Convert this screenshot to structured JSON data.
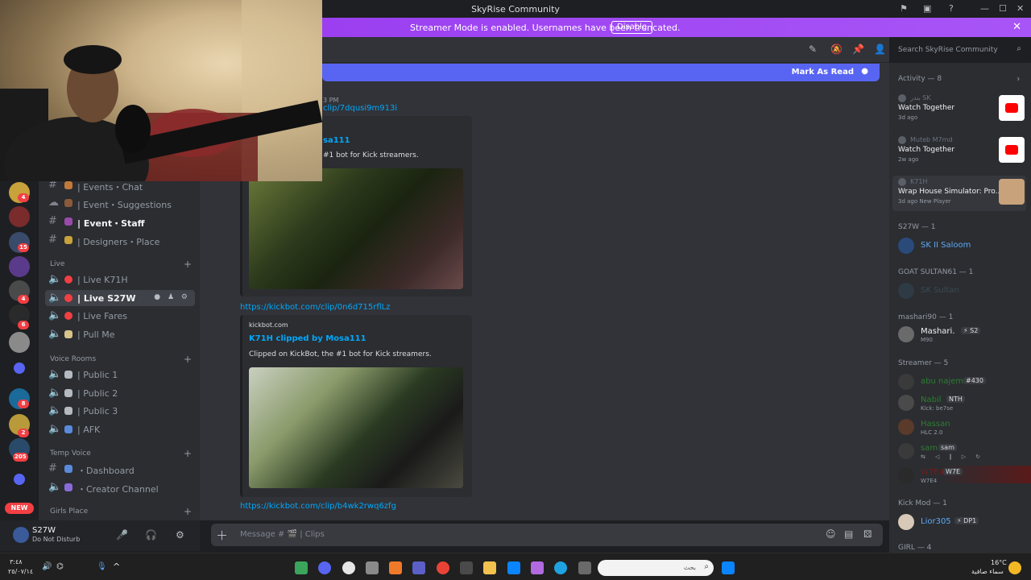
{
  "window": {
    "title": "SkyRise Community"
  },
  "banner": {
    "message": "Streamer Mode is enabled. Usernames have been truncated.",
    "disable_label": "Disable"
  },
  "header": {
    "search_placeholder": "Search SkyRise Community"
  },
  "new_messages_bar": {
    "mark_label": "Mark As Read"
  },
  "chat": {
    "timestamp": "3 PM",
    "link1": "clip/7dqusi9m913i",
    "embed1": {
      "title": "sa111",
      "desc": "#1 bot for Kick streamers."
    },
    "link2": "https://kickbot.com/clip/0n6d715rflLz",
    "embed2": {
      "site": "kickbot.com",
      "title": "K71H clipped by Mosa111",
      "desc": "Clipped on KickBot, the #1 bot for Kick streamers."
    },
    "link3": "https://kickbot.com/clip/b4wk2rwq6zfg",
    "composer_placeholder": "Message # 🎬 | Clips"
  },
  "channels": {
    "items": [
      {
        "label": "| Events・Chat",
        "type": "text"
      },
      {
        "label": "| Event・Suggestions",
        "type": "forum"
      },
      {
        "label": "| Event・Staff",
        "type": "text"
      },
      {
        "label": "| Designers・Place",
        "type": "text"
      }
    ],
    "live_category": "Live",
    "live": [
      {
        "label": "| Live K71H"
      },
      {
        "label": "| Live S27W"
      },
      {
        "label": "| Live Fares"
      },
      {
        "label": "| Pull Me"
      }
    ],
    "voice_category": "Voice Rooms",
    "voice": [
      {
        "label": "| Public 1"
      },
      {
        "label": "| Public 2"
      },
      {
        "label": "| Public 3"
      },
      {
        "label": "| AFK"
      }
    ],
    "temp_category": "Temp Voice",
    "temp": [
      {
        "label": "・Dashboard"
      },
      {
        "label": "・Creator Channel"
      }
    ],
    "girls_category": "Girls Place"
  },
  "user": {
    "name": "S27W",
    "status": "Do Not Disturb"
  },
  "servers": {
    "badges": [
      "4",
      "15",
      "4",
      "6",
      "8",
      "2",
      "205"
    ],
    "new_label": "NEW"
  },
  "activity": {
    "heading": "Activity — 8",
    "cards": [
      {
        "who": "بندر SK",
        "what": "Watch Together",
        "when": "3d ago"
      },
      {
        "who": "Muteb M7md",
        "what": "Watch Together",
        "when": "2w ago"
      },
      {
        "who": "K71H",
        "what": "Wrap House Simulator: Pro...",
        "when": "3d ago  New Player"
      }
    ],
    "groups": [
      {
        "title": "S27W — 1"
      },
      {
        "title": "GOAT SULTAN61 — 1"
      },
      {
        "title": "mashari90 — 1"
      },
      {
        "title": "Streamer — 5"
      },
      {
        "title": "Kick Mod — 1"
      },
      {
        "title": "GIRL — 4"
      }
    ],
    "members": {
      "s27w": {
        "name": "SK ⅠⅠ Saloom"
      },
      "goat": {
        "name": "SK Sultan"
      },
      "mashari": {
        "name": "Mashari.",
        "tag": "⚡ S2",
        "sub": "M90"
      },
      "streamers": [
        {
          "name": "abu najem",
          "tag": "#430"
        },
        {
          "name": "Nabil",
          "tag": "NTH",
          "sub": "Kick: be7se"
        },
        {
          "name": "Hassan",
          "sub": "HLC 2.0"
        },
        {
          "name": "sam",
          "tag": "sam"
        },
        {
          "name": "W7E4",
          "tag": "W7E",
          "sub": "W7E4"
        }
      ],
      "kickmod": {
        "name": "Lior305",
        "tag": "⚡ DP1"
      }
    }
  },
  "taskbar": {
    "search_placeholder": "بحث",
    "weather_temp": "16°C",
    "weather_desc": "سماء صافية",
    "time": "٣:٤٨",
    "date": "٢٥/٠٧/١٤"
  }
}
